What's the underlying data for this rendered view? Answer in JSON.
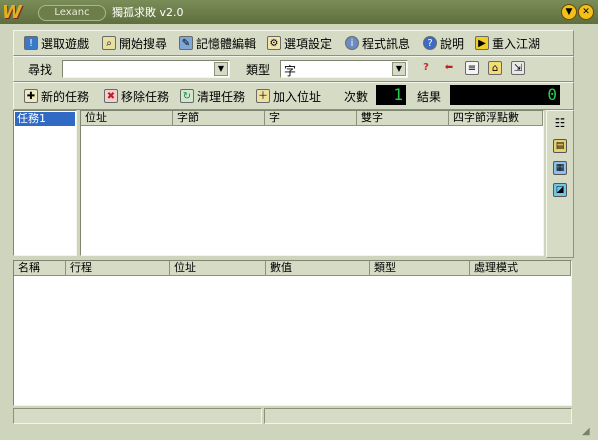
{
  "window": {
    "brand": "Lexanc",
    "title": "獨孤求敗 v2.0",
    "min_label": "▼",
    "close_label": "✕"
  },
  "toolbar": {
    "select_game": "選取遊戲",
    "start_search": "開始搜尋",
    "memory_editor": "記憶體編輯",
    "options": "選項設定",
    "program_info": "程式訊息",
    "help": "說明",
    "enter": "重入江湖"
  },
  "search": {
    "find_label": "尋找",
    "find_value": "",
    "type_label": "類型",
    "type_value": "字"
  },
  "tasks": {
    "new_task": "新的任務",
    "remove_task": "移除任務",
    "clear_task": "清理任務",
    "add_address": "加入位址",
    "count_label": "次數",
    "count_value": "1",
    "result_label": "結果",
    "result_value": "0"
  },
  "task_list": [
    "任務1"
  ],
  "results_headers": [
    "位址",
    "字節",
    "字",
    "雙字",
    "四字節浮點數"
  ],
  "watch_headers": [
    "名稱",
    "行程",
    "位址",
    "數值",
    "類型",
    "處理模式"
  ],
  "icons": {
    "select_game": "warning-icon",
    "start_search": "magnifier-icon",
    "memory_editor": "memory-edit-icon",
    "options": "settings-icon",
    "program_info": "info-icon",
    "help": "help-icon",
    "enter": "enter-icon"
  }
}
